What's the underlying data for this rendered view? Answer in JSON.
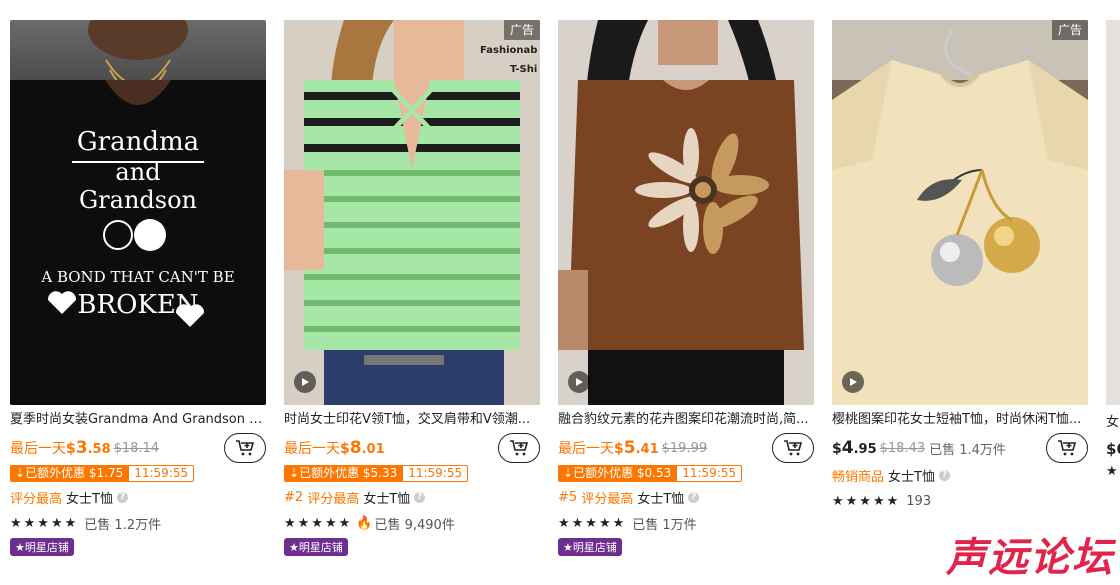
{
  "products": [
    {
      "title": "夏季时尚女装Grandma And Grandson A...",
      "price_prefix": "最后一天",
      "price_cur": "$",
      "price_int": "3",
      "price_dec": ".58",
      "orig_price": "$18.14",
      "promo_text": "已额外优惠 $1.75",
      "timer": "11:59:55",
      "rank": "",
      "tag": "评分最高",
      "category": "女士T恤",
      "sold": "已售 1.2万件",
      "badge": "明星店铺",
      "image_text": {
        "line1": "Grandma",
        "line2": "and",
        "line3": "Grandson",
        "line4": "A BOND THAT CAN'T BE",
        "line5": "BROKEN"
      }
    },
    {
      "title": "时尚女士印花V领T恤，交叉肩带和V领潮...",
      "ad": "广告",
      "image_text": {
        "overlay": "Fashionab",
        "overlay2": "T-Shi"
      },
      "price_prefix": "最后一天",
      "price_cur": "$",
      "price_int": "8",
      "price_dec": ".01",
      "promo_text": "已额外优惠 $5.33",
      "timer": "11:59:55",
      "rank": "#2",
      "tag": "评分最高",
      "category": "女士T恤",
      "sold": "已售 9,490件",
      "badge": "明星店铺"
    },
    {
      "title": "融合豹纹元素的花卉图案印花潮流时尚,简...",
      "price_prefix": "最后一天",
      "price_cur": "$",
      "price_int": "5",
      "price_dec": ".41",
      "orig_price": "$19.99",
      "promo_text": "已额外优惠 $0.53",
      "timer": "11:59:55",
      "rank": "#5",
      "tag": "评分最高",
      "category": "女士T恤",
      "sold": "已售 1万件",
      "badge": "明星店铺"
    },
    {
      "title": "樱桃图案印花女士短袖T恤，时尚休闲T恤...",
      "ad": "广告",
      "price_cur": "$",
      "price_int": "4",
      "price_dec": ".95",
      "orig_price": "$18.43",
      "sold_inline": "已售 1.4万件",
      "tag": "畅销商品",
      "category": "女士T恤",
      "rating_count": "193"
    }
  ],
  "partial_card": {
    "title": "女",
    "price": "$6"
  },
  "watermark": "声远论坛",
  "colors": {
    "accent": "#fb7701",
    "badge_purple": "#6d2e8f",
    "watermark_red": "#e2234a"
  }
}
